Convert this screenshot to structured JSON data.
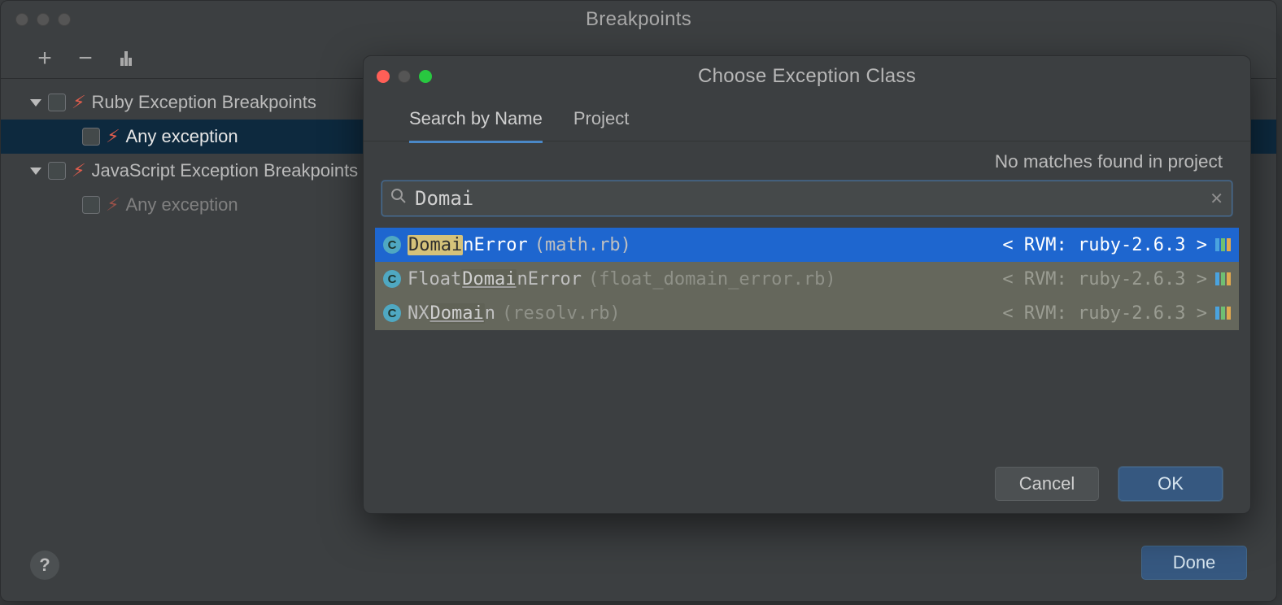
{
  "bp_window": {
    "title": "Breakpoints",
    "toolbar": {
      "add": "+",
      "remove": "−"
    },
    "tree": [
      {
        "label": "Ruby Exception Breakpoints",
        "kind": "group",
        "children": [
          {
            "label": "Any exception",
            "selected": true
          }
        ]
      },
      {
        "label": "JavaScript Exception Breakpoints",
        "kind": "group",
        "children": [
          {
            "label": "Any exception",
            "muted": true
          }
        ]
      }
    ],
    "done_label": "Done",
    "help_label": "?"
  },
  "dialog": {
    "title": "Choose Exception Class",
    "tabs": [
      "Search by Name",
      "Project"
    ],
    "active_tab": 0,
    "status_text": "No matches found in project",
    "search": {
      "value": "Domai"
    },
    "results": [
      {
        "highlight": "Domai",
        "rest": "nError",
        "file": "(math.rb)",
        "rvm": "< RVM: ruby-2.6.3 >",
        "selected": true
      },
      {
        "highlight": "",
        "name_before": "Float",
        "name_hl": "Domai",
        "name_after": "nError",
        "file": "(float_domain_error.rb)",
        "rvm": "< RVM: ruby-2.6.3 >"
      },
      {
        "highlight": "",
        "name_before": "NX",
        "name_hl": "Domai",
        "name_after": "n",
        "file": "(resolv.rb)",
        "rvm": "< RVM: ruby-2.6.3 >"
      }
    ],
    "buttons": {
      "cancel": "Cancel",
      "ok": "OK"
    }
  }
}
